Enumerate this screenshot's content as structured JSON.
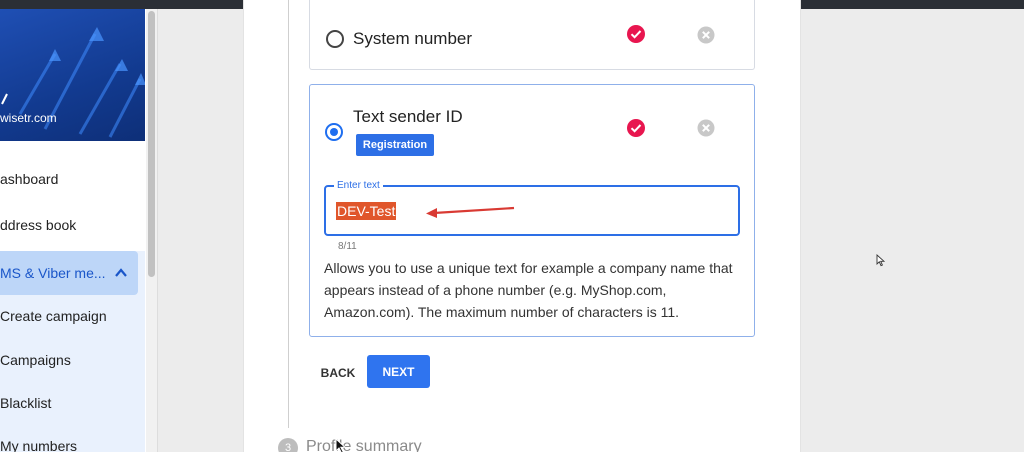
{
  "sidebar": {
    "brand_url": "wisetr.com",
    "items": [
      {
        "label": "ashboard"
      },
      {
        "label": "ddress book"
      }
    ],
    "group": {
      "label": "MS & Viber me...",
      "items": [
        {
          "label": "Create campaign"
        },
        {
          "label": "Campaigns"
        },
        {
          "label": "Blacklist"
        },
        {
          "label": "My numbers"
        }
      ]
    }
  },
  "sender_options": [
    {
      "title": "System number",
      "selected": false
    },
    {
      "title": "Text sender ID",
      "selected": true,
      "badge": "Registration"
    }
  ],
  "text_field": {
    "label": "Enter text",
    "value": "DEV-Test",
    "counter": "8/11"
  },
  "description": "Allows you to use a unique text for example a company name that appears instead of a phone number (e.g. MyShop.com, Amazon.com). The maximum number of characters is 11.",
  "buttons": {
    "back": "BACK",
    "next": "NEXT"
  },
  "next_step": {
    "number": "3",
    "label": "Profile summary"
  },
  "colors": {
    "accent": "#2d6fe6",
    "check": "#e8164f",
    "selection": "#e0562b",
    "annotation_arrow": "#d93a33"
  },
  "icons": {
    "check": "check-circle-icon",
    "cancel": "cancel-circle-icon",
    "collapse": "chevron-up-icon"
  }
}
